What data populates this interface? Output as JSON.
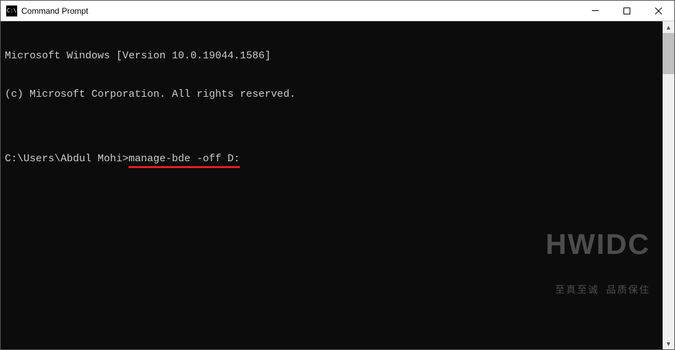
{
  "window": {
    "title": "Command Prompt",
    "icon_glyph": "C:\\"
  },
  "terminal": {
    "line1": "Microsoft Windows [Version 10.0.19044.1586]",
    "line2": "(c) Microsoft Corporation. All rights reserved.",
    "blank": "",
    "prompt": "C:\\Users\\Abdul Mohi>",
    "command": "manage-bde -off D:"
  },
  "watermark": {
    "main": "HWIDC",
    "sub": "至真至诚 品质保住"
  }
}
